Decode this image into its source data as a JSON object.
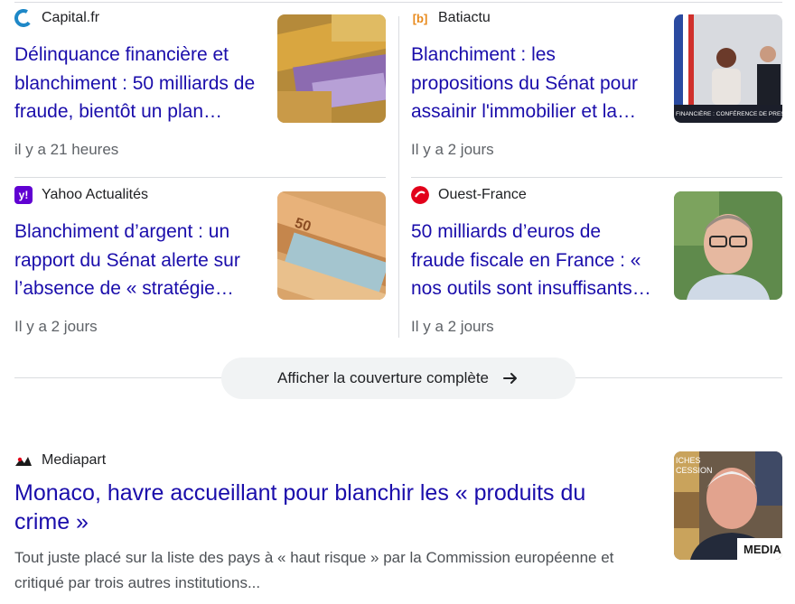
{
  "cards": [
    {
      "source": "Capital.fr",
      "logo_icon": "capital-fr-logo-icon",
      "title": "Délinquance financière et blanchiment : 50 milliards de fraude, bientôt un plan…",
      "time": "il y a 21 heures",
      "thumb": "euro-banknotes-image"
    },
    {
      "source": "Batiactu",
      "logo_icon": "batiactu-logo-icon",
      "logo_text": "[b]",
      "title": "Blanchiment : les propositions du Sénat pour assainir l'immobilier et la construction",
      "time": "Il y a 2 jours",
      "thumb": "press-conference-image",
      "thumb_caption": "FINANCIÈRE : CONFÉRENCE DE PRES"
    },
    {
      "source": "Yahoo Actualités",
      "logo_icon": "yahoo-logo-icon",
      "logo_text": "y!",
      "title": "Blanchiment d’argent : un rapport du Sénat alerte sur l’absence de « stratégie…",
      "time": "Il y a 2 jours",
      "thumb": "euro-notes-stack-image"
    },
    {
      "source": "Ouest-France",
      "logo_icon": "ouest-france-logo-icon",
      "title": "50 milliards d’euros de fraude fiscale en France : « nos outils sont insuffisants »…",
      "time": "Il y a 2 jours",
      "thumb": "portrait-man-glasses-image"
    }
  ],
  "more_button": {
    "label": "Afficher la couverture complète"
  },
  "story": {
    "source": "Mediapart",
    "title": "Monaco, havre accueillant pour blanchir les « produits du crime »",
    "snippet": "Tout juste placé sur la liste des pays à « haut risque » par la Commission européenne et critiqué par trois autres institutions...",
    "thumb_text_top": "ICHES\nCESSION",
    "thumb_text_bottom": "MEDIA"
  },
  "colors": {
    "link": "#1a0dab",
    "meta": "#5f6368",
    "divider": "#dadce0",
    "button_bg": "#f1f3f4"
  }
}
